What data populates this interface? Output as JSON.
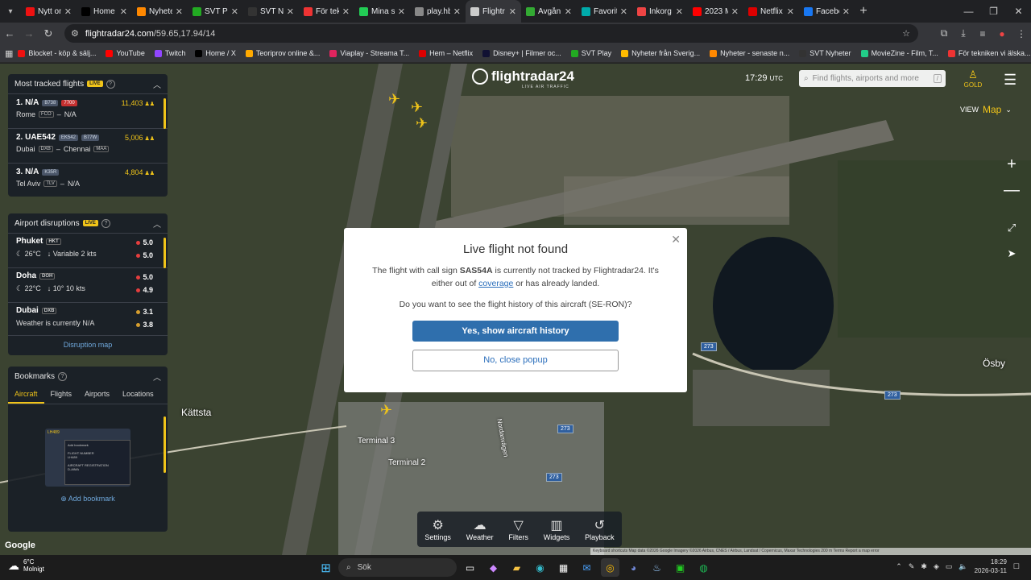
{
  "browser": {
    "tabs": [
      {
        "title": "Nytt om",
        "color": "#e11"
      },
      {
        "title": "Home /",
        "color": "#000"
      },
      {
        "title": "Nyhete",
        "color": "#f80"
      },
      {
        "title": "SVT Pl",
        "color": "#2a2"
      },
      {
        "title": "SVT Ny",
        "color": "#333"
      },
      {
        "title": "För tek",
        "color": "#e33"
      },
      {
        "title": "Mina s",
        "color": "#2c5"
      },
      {
        "title": "play.hb",
        "color": "#888"
      },
      {
        "title": "Flightr",
        "color": "#ccc"
      },
      {
        "title": "Avgån",
        "color": "#3a3"
      },
      {
        "title": "Favorit",
        "color": "#0aa"
      },
      {
        "title": "Inkorg",
        "color": "#e44"
      },
      {
        "title": "2023 M",
        "color": "#f00"
      },
      {
        "title": "Netflix",
        "color": "#d00"
      },
      {
        "title": "Facebo",
        "color": "#1877f2"
      }
    ],
    "active_tab": 8,
    "url_host": "flightradar24.com",
    "url_path": "/59.65,17.94/14",
    "bookmarks": [
      {
        "label": "Blocket - köp & sälj...",
        "color": "#e11"
      },
      {
        "label": "YouTube",
        "color": "#f00"
      },
      {
        "label": "Twitch",
        "color": "#9146ff"
      },
      {
        "label": "Home / X",
        "color": "#000"
      },
      {
        "label": "Teoriprov online &...",
        "color": "#fa0"
      },
      {
        "label": "Viaplay - Streama T...",
        "color": "#e0245e"
      },
      {
        "label": "Hem – Netflix",
        "color": "#d00"
      },
      {
        "label": "Disney+ | Filmer oc...",
        "color": "#113"
      },
      {
        "label": "SVT Play",
        "color": "#2a2"
      },
      {
        "label": "Nyheter från Sverig...",
        "color": "#fb0"
      },
      {
        "label": "Nyheter - senaste n...",
        "color": "#f80"
      },
      {
        "label": "SVT Nyheter",
        "color": "#333"
      },
      {
        "label": "MovieZine - Film, T...",
        "color": "#2c8"
      },
      {
        "label": "För tekniken vi älska...",
        "color": "#e33"
      }
    ]
  },
  "fr24": {
    "logo": "flightradar24",
    "logo_sub": "LIVE AIR TRAFFIC",
    "time": "17:29",
    "time_zone": "UTC",
    "search_placeholder": "Find flights, airports and more",
    "search_key": "/",
    "gold_label": "GOLD",
    "view_label": "VIEW",
    "view_value": "Map",
    "most_tracked": {
      "title": "Most tracked flights",
      "live": "LIVE",
      "items": [
        {
          "rank_call": "1. N/A",
          "type": "B738",
          "squawk": "7700",
          "count": "11,403",
          "from": "Rome",
          "from_code": "FCO",
          "to": "N/A",
          "to_code": ""
        },
        {
          "rank_call": "2. UAE542",
          "type": "EK542",
          "type2": "B77W",
          "count": "5,006",
          "from": "Dubai",
          "from_code": "DXB",
          "to": "Chennai",
          "to_code": "MAA"
        },
        {
          "rank_call": "3. N/A",
          "type": "K35R",
          "count": "4,804",
          "from": "Tel Aviv",
          "from_code": "TLV",
          "to": "N/A",
          "to_code": ""
        }
      ]
    },
    "disruptions": {
      "title": "Airport disruptions",
      "live": "LIVE",
      "items": [
        {
          "name": "Phuket",
          "code": "HKT",
          "temp": "26°C",
          "wind": "Variable 2 kts",
          "dep": "5.0",
          "arr": "5.0",
          "dep_color": "#e53e3e",
          "arr_color": "#e53e3e"
        },
        {
          "name": "Doha",
          "code": "DOH",
          "temp": "22°C",
          "wind": "10° 10 kts",
          "dep": "5.0",
          "arr": "4.9",
          "dep_color": "#e53e3e",
          "arr_color": "#e53e3e"
        },
        {
          "name": "Dubai",
          "code": "DXB",
          "temp": "",
          "wind": "Weather is currently N/A",
          "dep": "3.1",
          "arr": "3.8",
          "dep_color": "#d69e2e",
          "arr_color": "#d69e2e"
        }
      ],
      "link": "Disruption map"
    },
    "bookmarks": {
      "title": "Bookmarks",
      "tabs": [
        "Aircraft",
        "Flights",
        "Airports",
        "Locations"
      ],
      "active": 0,
      "card_title": "LH489",
      "card_heading": "Add bookmark",
      "card_line1": "FLIGHT NUMBER",
      "card_line1b": "LH489",
      "card_line2": "AIRCRAFT REGISTRATION",
      "card_line2b": "D-AIMA",
      "add_label": "Add bookmark"
    },
    "map_labels": {
      "kattsta": "Kättsta",
      "osby": "Ösby",
      "terminal3": "Terminal 3",
      "terminal2": "Terminal 2",
      "nordanvagen": "Nordanvägen",
      "road": "273",
      "google": "Google",
      "attribution": "Keyboard shortcuts   Map data ©2026 Google Imagery ©2026 Airbus, CNES / Airbus, Landsat / Copernicus, Maxar Technologies   200 m   Terms   Report a map error"
    },
    "modal": {
      "title": "Live flight not found",
      "p1_pre": "The flight with call sign ",
      "callsign": "SAS54A",
      "p1_mid": " is currently not tracked by Flightradar24. It's either out of ",
      "coverage": "coverage",
      "p1_post": " or has already landed.",
      "p2": "Do you want to see the flight history of this aircraft (SE-RON)?",
      "yes": "Yes, show aircraft history",
      "no": "No, close popup"
    },
    "toolbar": [
      {
        "label": "Settings",
        "icon": "gear-icon",
        "glyph": "⚙"
      },
      {
        "label": "Weather",
        "icon": "weather-icon",
        "glyph": "☁"
      },
      {
        "label": "Filters",
        "icon": "filter-icon",
        "glyph": "▽"
      },
      {
        "label": "Widgets",
        "icon": "widgets-icon",
        "glyph": "▥"
      },
      {
        "label": "Playback",
        "icon": "playback-icon",
        "glyph": "↺"
      }
    ]
  },
  "taskbar": {
    "temp": "6°C",
    "condition": "Molnigt",
    "search": "Sök",
    "time": "18:29",
    "date": "2026-03-11"
  }
}
